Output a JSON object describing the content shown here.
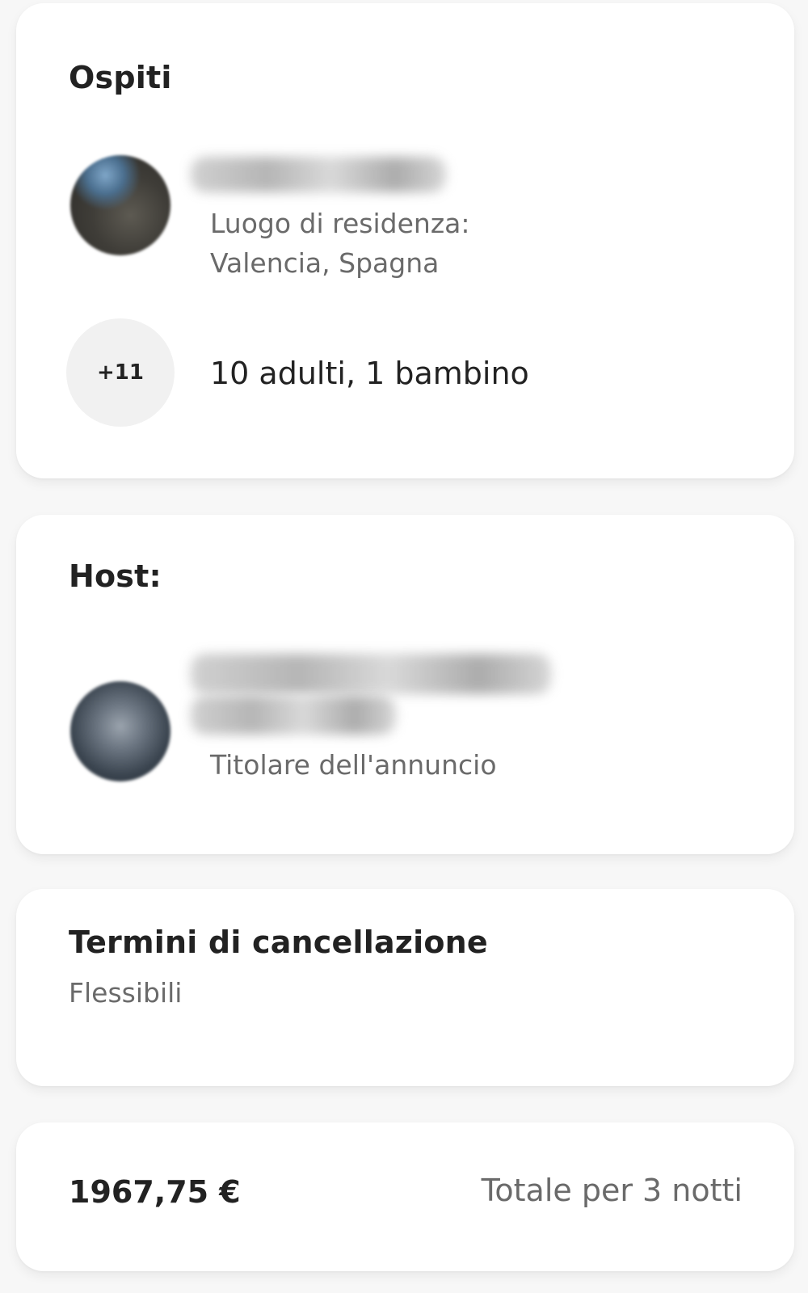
{
  "guests_section": {
    "title": "Ospiti",
    "residence_label": "Luogo di residenza:",
    "residence_value": "Valencia, Spagna",
    "extra_guests_badge": "+11",
    "guest_summary": "10 adulti, 1 bambino"
  },
  "host_section": {
    "title": "Host:",
    "role": "Titolare dell'annuncio"
  },
  "cancellation_section": {
    "title": "Termini di cancellazione",
    "policy": "Flessibili"
  },
  "total_section": {
    "price": "1967,75 €",
    "label": "Totale per 3 notti"
  }
}
